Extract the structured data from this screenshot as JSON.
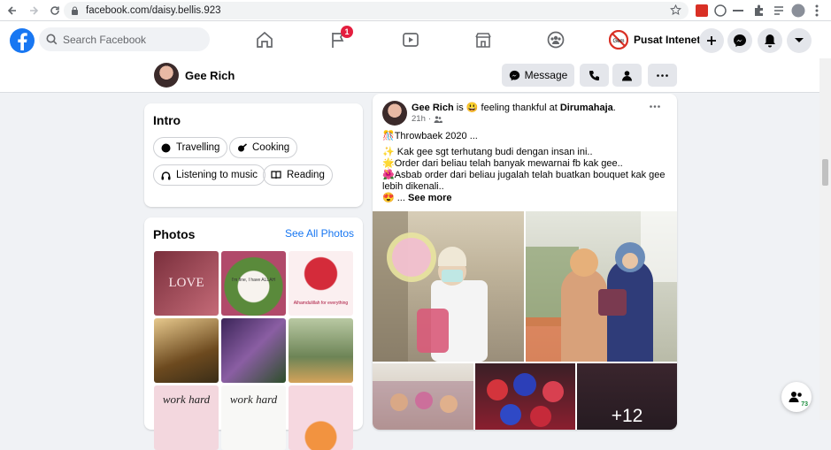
{
  "browser": {
    "url": "facebook.com/daisy.bellis.923"
  },
  "header": {
    "search_placeholder": "Search Facebook",
    "notif_count": "1",
    "user_name": "Pusat Intenet"
  },
  "profile": {
    "name": "Gee Rich",
    "message_label": "Message"
  },
  "intro": {
    "title": "Intro",
    "chips": [
      "Travelling",
      "Cooking",
      "Listening to music",
      "Reading"
    ]
  },
  "photos": {
    "title": "Photos",
    "see_all": "See All Photos",
    "captions": [
      "LOVE",
      "I'm fine, I have ALLAH",
      "Alhamdulillah for everything",
      "",
      "",
      "",
      "work hard",
      "work hard",
      ""
    ]
  },
  "post": {
    "author": "Gee Rich",
    "is_text": "is",
    "feeling_text": "feeling thankful at",
    "place": "Dirumahaja",
    "period": ".",
    "time": "21h",
    "lines": [
      "🎊Throwbaek 2020 ...",
      "✨ Kak gee sgt terhutang budi dengan insan ini..",
      "🌟Order dari beliau telah banyak mewarnai fb kak gee..",
      "🌺Asbab order dari beliau jugalah telah buatkan bouquet kak gee",
      "lebih dikenali.."
    ],
    "see_more_prefix": "😍 ...",
    "see_more": "See more",
    "more_photos": "+12"
  },
  "chat": {
    "count": "73"
  },
  "colors": {
    "brand": "#1877f2",
    "background": "#f0f2f5",
    "badge": "#e41e3f"
  }
}
